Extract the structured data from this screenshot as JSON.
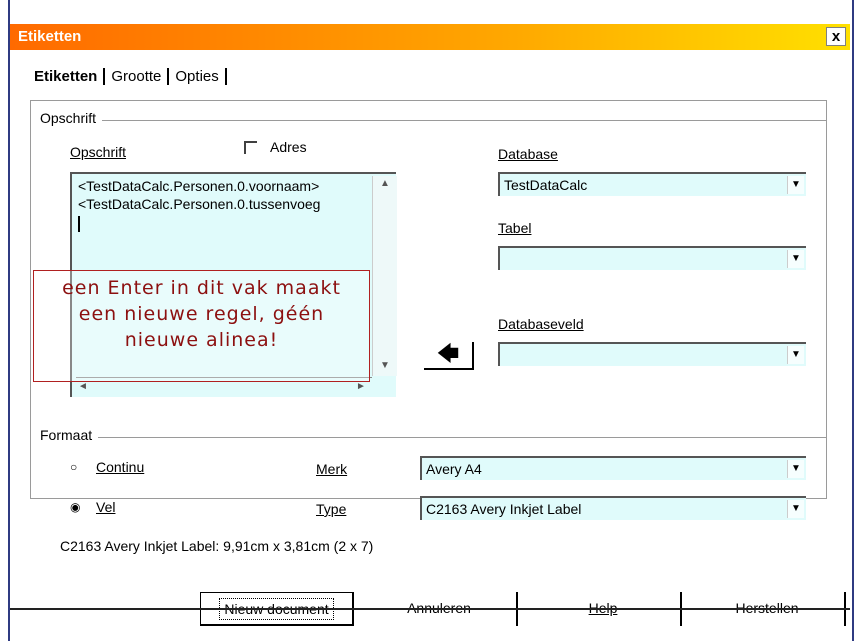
{
  "window": {
    "title": "Etiketten",
    "close_label": "x"
  },
  "tabs": [
    {
      "label": "Etiketten"
    },
    {
      "label": "Grootte"
    },
    {
      "label": "Opties"
    }
  ],
  "opschrift_group": {
    "title": "Opschrift",
    "field_label": "Opschrift",
    "adres_label": "Adres",
    "adres_checked": false,
    "lines": [
      "<TestDataCalc.Personen.0.voornaam>",
      "<TestDataCalc.Personen.0.tussenvoeg"
    ],
    "database_label": "Database",
    "database_value": "TestDataCalc",
    "tabel_label": "Tabel",
    "tabel_value": "",
    "databaseveld_label": "Databaseveld",
    "databaseveld_value": "",
    "insert_arrow": "🡄"
  },
  "callout": {
    "lines": [
      "een Enter in dit vak maakt",
      "een nieuwe regel, géén",
      "nieuwe alinea!"
    ]
  },
  "formaat_group": {
    "title": "Formaat",
    "continu_label": "Continu",
    "vel_label": "Vel",
    "selected": "Vel",
    "merk_label": "Merk",
    "merk_value": "Avery A4",
    "type_label": "Type",
    "type_value": "C2163 Avery Inkjet Label",
    "info_text": "C2163 Avery Inkjet Label: 9,91cm x 3,81cm (2 x 7)"
  },
  "buttons": {
    "new_document": "Nieuw document",
    "cancel": "Annuleren",
    "help": "Help",
    "reset": "Herstellen"
  },
  "colors": {
    "title_gradient_start": "#ff6a00",
    "title_gradient_end": "#ffe000",
    "field_background": "#e0fbfb",
    "callout_text": "#8c1010",
    "callout_border": "#b02020"
  }
}
